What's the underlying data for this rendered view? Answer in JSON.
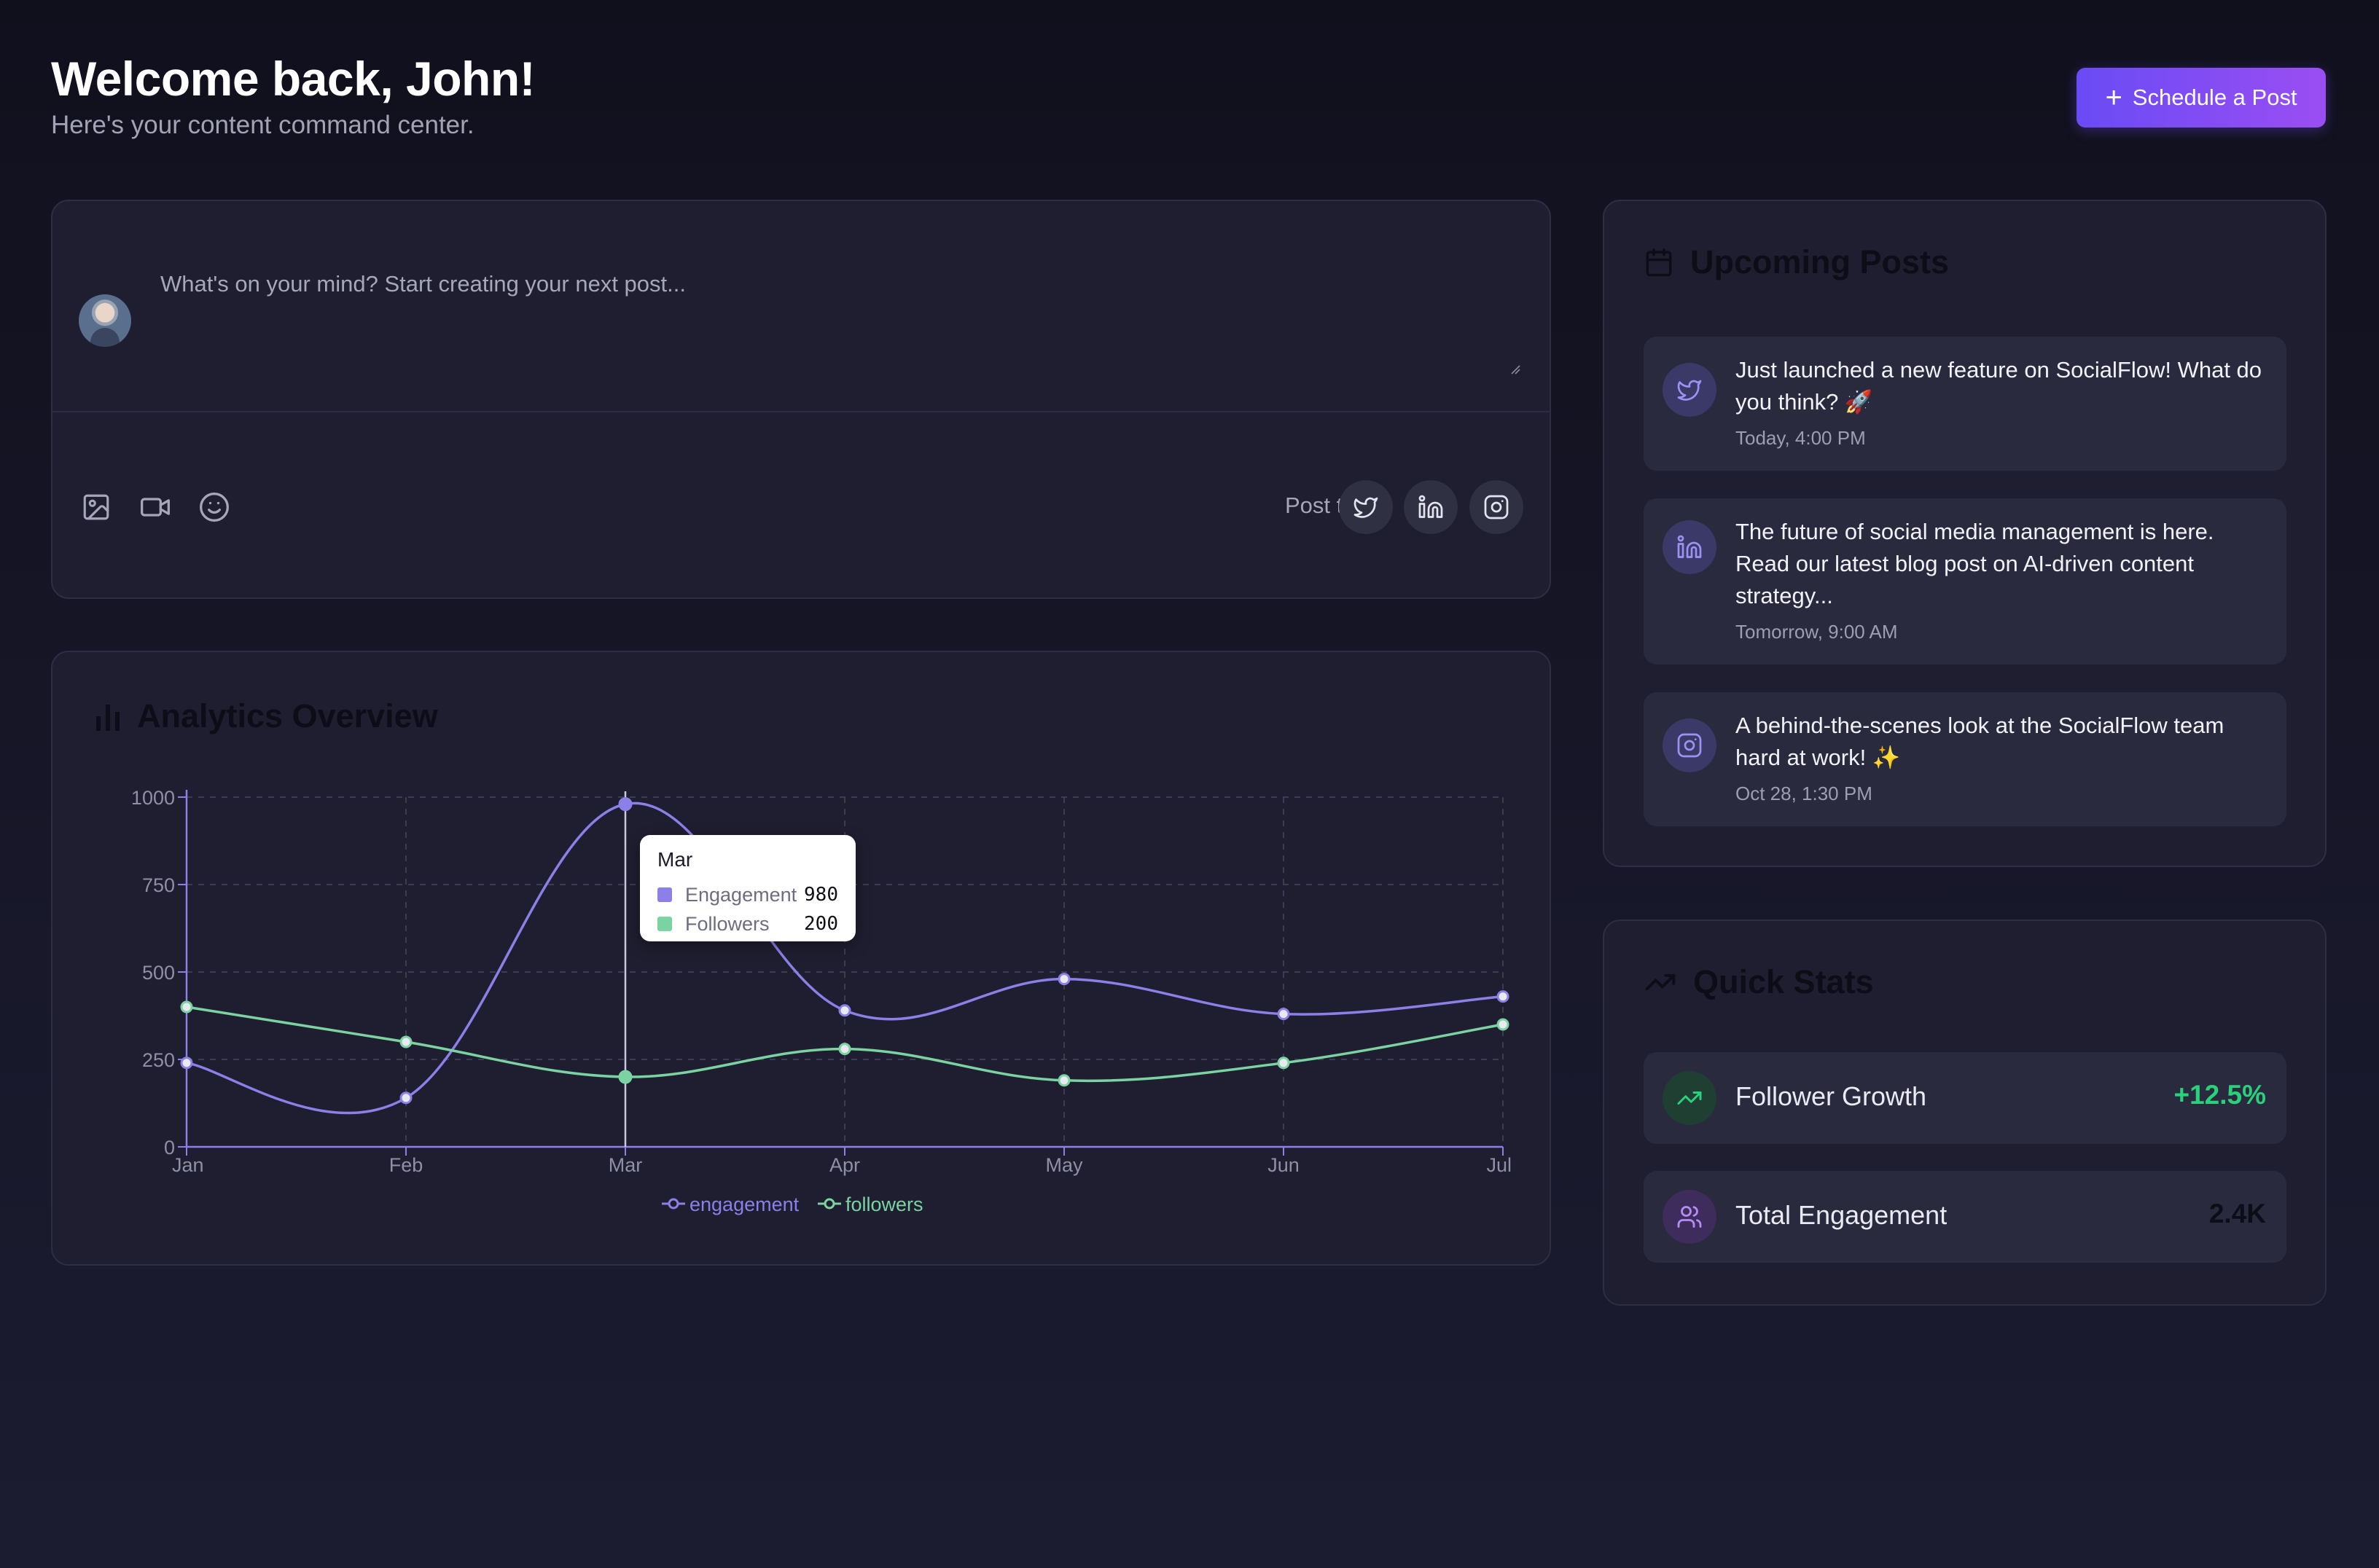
{
  "header": {
    "title": "Welcome back, John!",
    "subtitle": "Here's your content command center.",
    "schedule_button": "Schedule a Post"
  },
  "composer": {
    "placeholder": "What's on your mind? Start creating your next post...",
    "tools": [
      "image-icon",
      "video-icon",
      "smile-icon"
    ],
    "post_to_label": "Post to:",
    "platforms": [
      "twitter-icon",
      "linkedin-icon",
      "instagram-icon"
    ]
  },
  "analytics": {
    "title": "Analytics Overview",
    "tooltip": {
      "title": "Mar",
      "rows": [
        {
          "label": "Engagement",
          "value": "980",
          "color": "#8a80e8"
        },
        {
          "label": "Followers",
          "value": "200",
          "color": "#7ad3a0"
        }
      ]
    }
  },
  "chart_data": {
    "type": "line",
    "categories": [
      "Jan",
      "Feb",
      "Mar",
      "Apr",
      "May",
      "Jun",
      "Jul"
    ],
    "series": [
      {
        "name": "engagement",
        "values": [
          240,
          140,
          980,
          390,
          480,
          380,
          430
        ],
        "color": "#8a80e8"
      },
      {
        "name": "followers",
        "values": [
          400,
          300,
          200,
          280,
          190,
          240,
          350
        ],
        "color": "#7ad3a0"
      }
    ],
    "y_ticks": [
      "0",
      "250",
      "500",
      "750",
      "1000"
    ],
    "ylim": [
      0,
      1000
    ],
    "grid": true,
    "legend": "bottom-center",
    "highlighted_category": "Mar"
  },
  "upcoming": {
    "title": "Upcoming Posts",
    "posts": [
      {
        "platform": "twitter-icon",
        "text": "Just launched a new feature on SocialFlow! What do you think? 🚀",
        "time": "Today, 4:00 PM"
      },
      {
        "platform": "linkedin-icon",
        "text": "The future of social media management is here. Read our latest blog post on AI-driven content strategy...",
        "time": "Tomorrow, 9:00 AM"
      },
      {
        "platform": "instagram-icon",
        "text": "A behind-the-scenes look at the SocialFlow team hard at work! ✨",
        "time": "Oct 28, 1:30 PM"
      }
    ]
  },
  "quick_stats": {
    "title": "Quick Stats",
    "stats": [
      {
        "icon": "trending-up-icon",
        "label": "Follower Growth",
        "value": "+12.5%",
        "color": "#29d17a"
      },
      {
        "icon": "users-icon",
        "label": "Total Engagement",
        "value": "2.4K",
        "color": "#0d0d18"
      }
    ]
  }
}
